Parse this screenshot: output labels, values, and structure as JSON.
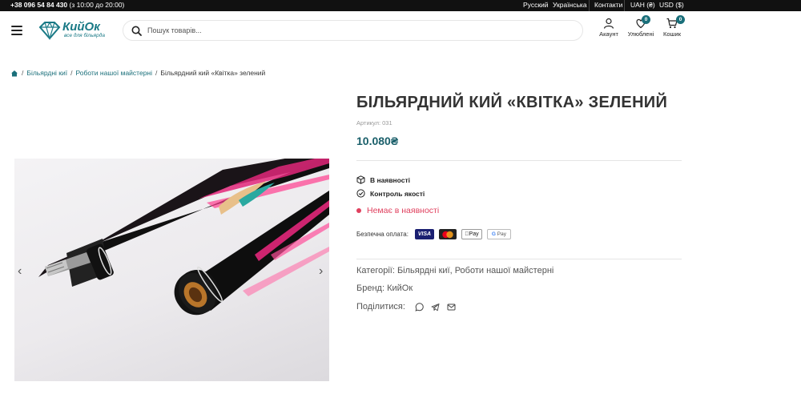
{
  "topbar": {
    "phone": "+38 096 54 84 430",
    "hours": "(з 10:00 до 20:00)",
    "lang_ru": "Русский",
    "lang_ua": "Українська",
    "contacts": "Контакти",
    "currency_uah": "UAH (₴)",
    "currency_usd": "USD ($)"
  },
  "header": {
    "logo_name": "КийОк",
    "logo_tagline": "все для більярда",
    "search_placeholder": "Пошук товарів...",
    "account_label": "Акаунт",
    "wishlist_label": "Улюблені",
    "wishlist_count": "0",
    "cart_label": "Кошик",
    "cart_count": "0",
    "accent_color": "#1a6f7a"
  },
  "breadcrumb": {
    "home_icon": "home-icon",
    "items": [
      "Більярдні киї",
      "Роботи нашої майстерні"
    ],
    "current": "Більярдний кий «Квітка» зелений"
  },
  "gallery": {
    "prev_arrow": "‹",
    "next_arrow": "›"
  },
  "product": {
    "title": "БІЛЬЯРДНИЙ КИЙ «КВІТКА» ЗЕЛЕНИЙ",
    "sku": "Артикул: 031",
    "price": "10.080₴",
    "feature_in_stock": "В наявності",
    "feature_quality": "Контроль якості",
    "stock_status": "Немає в наявності",
    "stock_color": "#e0405e",
    "payment_label": "Безпечна оплата:",
    "payment_methods": [
      "VISA",
      "Mastercard",
      "Apple Pay",
      "G Pay"
    ],
    "categories_label": "Категорії:",
    "categories": "Більярдні киї, Роботи нашої майстерні",
    "brand_label": "Бренд:",
    "brand": "КийОк",
    "share_label": "Поділитися:"
  }
}
